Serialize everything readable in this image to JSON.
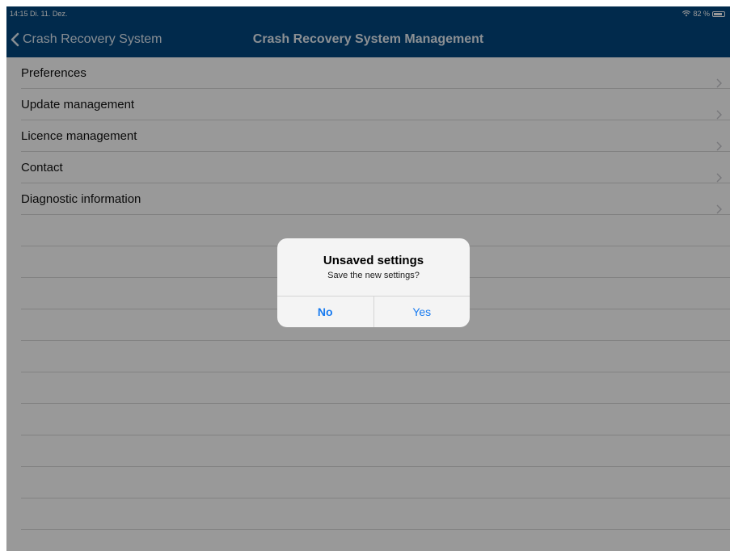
{
  "status_bar": {
    "time_date": "14:15  Di. 11. Dez.",
    "battery_text": "82 %",
    "icons": {
      "wifi": "wifi-icon",
      "battery": "battery-icon"
    },
    "battery_level": 0.82
  },
  "nav": {
    "back_label": "Crash Recovery System",
    "title": "Crash Recovery System Management",
    "back_icon": "chevron-left-icon"
  },
  "menu": {
    "items": [
      {
        "label": "Preferences"
      },
      {
        "label": "Update management"
      },
      {
        "label": "Licence management"
      },
      {
        "label": "Contact"
      },
      {
        "label": "Diagnostic information"
      }
    ],
    "empty_rows": 10,
    "row_icon": "chevron-right-icon"
  },
  "alert": {
    "title": "Unsaved settings",
    "message": "Save the new settings?",
    "no_label": "No",
    "yes_label": "Yes"
  },
  "colors": {
    "nav_background": "#02477f",
    "dim_overlay": "rgba(0,0,0,0.40)",
    "alert_button": "#1a7cf0"
  }
}
